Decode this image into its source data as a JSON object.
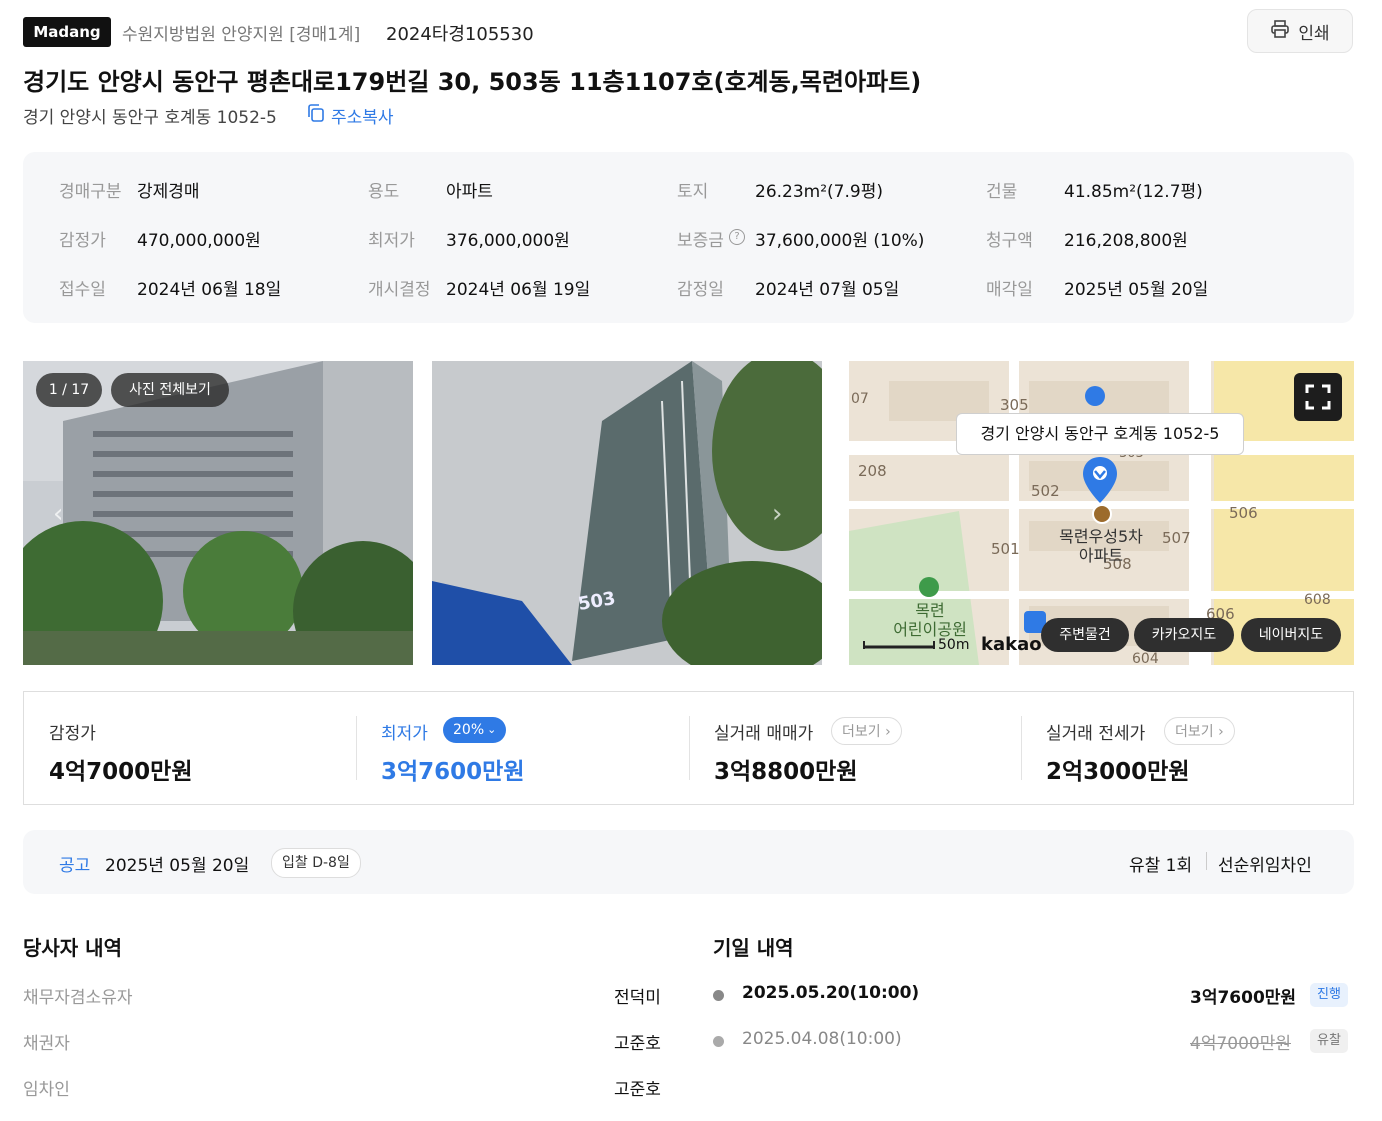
{
  "header": {
    "logo": "Madang",
    "court": "수원지방법원 안양지원 [경매1계]",
    "case_number": "2024타경105530",
    "print_label": "인쇄"
  },
  "title": "경기도 안양시 동안구 평촌대로179번길 30, 503동 11층1107호(호계동,목련아파트)",
  "lot_address": "경기 안양시 동안구 호계동 1052-5",
  "copy_address_label": "주소복사",
  "info": [
    [
      {
        "k": "경매구분",
        "v": "강제경매"
      },
      {
        "k": "용도",
        "v": "아파트"
      },
      {
        "k": "토지",
        "v": "26.23m²(7.9평)"
      },
      {
        "k": "건물",
        "v": "41.85m²(12.7평)"
      }
    ],
    [
      {
        "k": "감정가",
        "v": "470,000,000원"
      },
      {
        "k": "최저가",
        "v": "376,000,000원"
      },
      {
        "k": "보증금",
        "v": "37,600,000원 (10%)"
      },
      {
        "k": "청구액",
        "v": "216,208,800원"
      }
    ],
    [
      {
        "k": "접수일",
        "v": "2024년 06월 18일"
      },
      {
        "k": "개시결정",
        "v": "2024년 06월 19일"
      },
      {
        "k": "감정일",
        "v": "2024년 07월 05일"
      },
      {
        "k": "매각일",
        "v": "2025년 05월 20일"
      }
    ]
  ],
  "photos": {
    "counter": "1 / 17",
    "view_all": "사진 전체보기",
    "building_label": "503"
  },
  "map": {
    "tooltip": "경기 안양시 동안구 호계동 1052-5",
    "place_name_line1": "목련우성5차",
    "place_name_line2": "아파트",
    "park_line1": "목련",
    "park_line2": "어린이공원",
    "labels": [
      "07",
      "305",
      "208",
      "502",
      "506",
      "507",
      "501",
      "508",
      "606",
      "604",
      "608",
      "303"
    ],
    "scale": "50m",
    "brand": "kakao",
    "buttons": [
      "주변물건",
      "카카오지도",
      "네이버지도"
    ]
  },
  "prices": {
    "appraisal": {
      "label": "감정가",
      "value": "4억7000만원"
    },
    "minimum": {
      "label": "최저가",
      "badge": "20%",
      "value": "3억7600만원"
    },
    "trade": {
      "label": "실거래 매매가",
      "more": "더보기",
      "value": "3억8800만원"
    },
    "jeonse": {
      "label": "실거래 전세가",
      "more": "더보기",
      "value": "2억3000만원"
    }
  },
  "notice": {
    "tag": "공고",
    "date": "2025년 05월 20일",
    "dday": "입찰 D-8일",
    "fail_count": "유찰 1회",
    "tenant": "선순위임차인"
  },
  "parties": {
    "title": "당사자 내역",
    "rows": [
      {
        "role": "채무자겸소유자",
        "name": "전덕미"
      },
      {
        "role": "채권자",
        "name": "고준호"
      },
      {
        "role": "임차인",
        "name": "고준호"
      }
    ]
  },
  "schedule": {
    "title": "기일 내역",
    "rows": [
      {
        "date": "2025.05.20(10:00)",
        "price": "3억7600만원",
        "status": "진행"
      },
      {
        "date": "2025.04.08(10:00)",
        "price": "4억7000만원",
        "status": "유찰"
      }
    ]
  },
  "colors": {
    "accent": "#2f7ae5",
    "badge_bg": "#2f7ae5",
    "map_marker": "#2f7ae5"
  }
}
